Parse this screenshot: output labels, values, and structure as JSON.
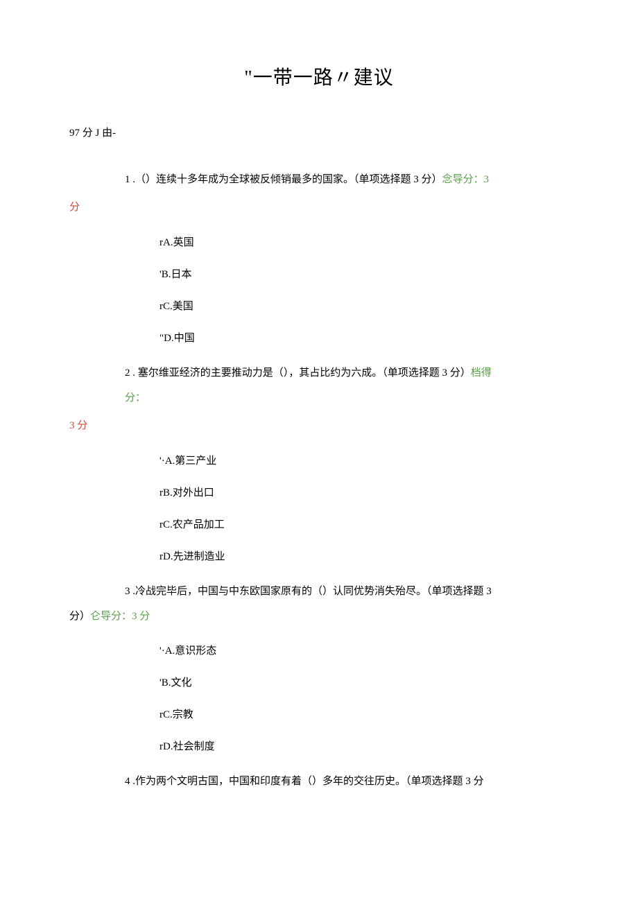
{
  "title": "\"一带一路〃建议",
  "score_line": "97 分 J 由-",
  "q1": {
    "stem_a": "1 .（）连续十多年成为全球被反倾销最多的国家。（单项选择题 3 分）",
    "score_label": "念导分：3",
    "score_tail": "分",
    "options": {
      "a": "rA.英国",
      "b": "'B.日本",
      "c": "rC.美国",
      "d": "\"D.中国"
    }
  },
  "q2": {
    "stem_a": "2 . 塞尔维亚经济的主要推动力是（），其占比约为六成。（单项选择题 3 分）",
    "score_label": "档得",
    "score_line2": "分：",
    "score_tail": "3 分",
    "options": {
      "a": "'·A.第三产业",
      "b": "rB.对外出口",
      "c": "rC.农产品加工",
      "d": "rD.先进制造业"
    }
  },
  "q3": {
    "stem_a": "3 .冷战完毕后，中国与中东欧国家原有的（）认同优势消失殆尽。（单项选择题 3",
    "stem_b": "分）",
    "score_label": "仑导分：3 分",
    "options": {
      "a": "'·A.意识形态",
      "b": "'B.文化",
      "c": "rC.宗教",
      "d": "rD.社会制度"
    }
  },
  "q4": {
    "stem_a": "4 .作为两个文明古国，中国和印度有着（）多年的交往历史。（单项选择题 3 分"
  }
}
